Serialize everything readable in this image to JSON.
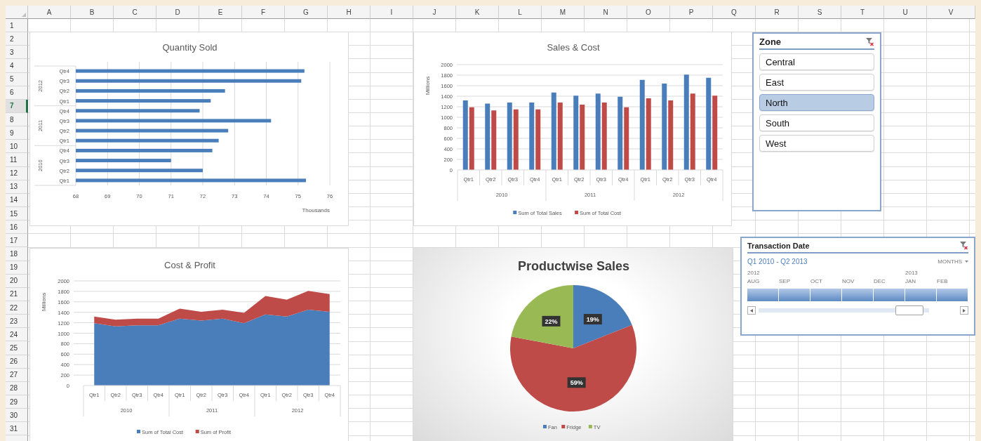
{
  "sheet": {
    "columns": [
      {
        "label": "A",
        "selected": false
      },
      {
        "label": "B",
        "selected": false
      },
      {
        "label": "C",
        "selected": false
      },
      {
        "label": "D",
        "selected": false
      },
      {
        "label": "E",
        "selected": false
      },
      {
        "label": "F",
        "selected": false
      },
      {
        "label": "G",
        "selected": false
      },
      {
        "label": "H",
        "selected": false
      },
      {
        "label": "I",
        "selected": false
      },
      {
        "label": "J",
        "selected": false
      },
      {
        "label": "K",
        "selected": false
      },
      {
        "label": "L",
        "selected": false
      },
      {
        "label": "M",
        "selected": false
      },
      {
        "label": "N",
        "selected": false
      },
      {
        "label": "O",
        "selected": false
      },
      {
        "label": "P",
        "selected": false
      },
      {
        "label": "Q",
        "selected": false
      },
      {
        "label": "R",
        "selected": false
      },
      {
        "label": "S",
        "selected": false
      },
      {
        "label": "T",
        "selected": false
      },
      {
        "label": "U",
        "selected": false
      },
      {
        "label": "V",
        "selected": false
      }
    ],
    "rows": [
      {
        "label": "1",
        "selected": false
      },
      {
        "label": "2",
        "selected": false
      },
      {
        "label": "3",
        "selected": false
      },
      {
        "label": "4",
        "selected": false
      },
      {
        "label": "5",
        "selected": false
      },
      {
        "label": "6",
        "selected": false
      },
      {
        "label": "7",
        "selected": true
      },
      {
        "label": "8",
        "selected": false
      },
      {
        "label": "9",
        "selected": false
      },
      {
        "label": "10",
        "selected": false
      },
      {
        "label": "11",
        "selected": false
      },
      {
        "label": "12",
        "selected": false
      },
      {
        "label": "13",
        "selected": false
      },
      {
        "label": "14",
        "selected": false
      },
      {
        "label": "15",
        "selected": false
      },
      {
        "label": "16",
        "selected": false
      },
      {
        "label": "17",
        "selected": false
      },
      {
        "label": "18",
        "selected": false
      },
      {
        "label": "19",
        "selected": false
      },
      {
        "label": "20",
        "selected": false
      },
      {
        "label": "21",
        "selected": false
      },
      {
        "label": "22",
        "selected": false
      },
      {
        "label": "23",
        "selected": false
      },
      {
        "label": "24",
        "selected": false
      },
      {
        "label": "25",
        "selected": false
      },
      {
        "label": "26",
        "selected": false
      },
      {
        "label": "27",
        "selected": false
      },
      {
        "label": "28",
        "selected": false
      },
      {
        "label": "29",
        "selected": false
      },
      {
        "label": "30",
        "selected": false
      },
      {
        "label": "31",
        "selected": false
      }
    ]
  },
  "charts": [
    {
      "axis_groups": [
        "2012",
        "2011",
        "2010"
      ],
      "chart_data": {
        "type": "bar",
        "orientation": "horizontal",
        "title": "Quantity Sold",
        "xlabel": "Thousands",
        "grid": true,
        "color": "#4a7ebb",
        "categories": [
          "Qtr4",
          "Qtr3",
          "Qtr2",
          "Qtr1",
          "Qtr4",
          "Qtr3",
          "Qtr2",
          "Qtr1",
          "Qtr4",
          "Qtr3",
          "Qtr2",
          "Qtr1"
        ],
        "values": [
          75.2,
          75.1,
          72.7,
          72.25,
          71.9,
          74.15,
          72.8,
          72.5,
          72.3,
          71.0,
          72.0,
          75.25
        ],
        "xlim": [
          68,
          76
        ],
        "xticks": [
          68,
          69,
          70,
          71,
          72,
          73,
          74,
          75,
          76
        ]
      }
    },
    {
      "axis_groups": [
        "2010",
        "2011",
        "2012"
      ],
      "chart_data": {
        "type": "bar",
        "orientation": "vertical",
        "title": "Sales & Cost",
        "ylabel": "Millions",
        "grid": true,
        "legend": "bottom",
        "categories": [
          "Qtr1",
          "Qtr2",
          "Qtr3",
          "Qtr4",
          "Qtr1",
          "Qtr2",
          "Qtr3",
          "Qtr4",
          "Qtr1",
          "Qtr2",
          "Qtr3",
          "Qtr4"
        ],
        "series": [
          {
            "name": "Sum of Total Sales",
            "color": "#4a7ebb",
            "values": [
              1320,
              1260,
              1280,
              1280,
              1470,
              1410,
              1450,
              1390,
              1710,
              1640,
              1810,
              1750
            ]
          },
          {
            "name": "Sum of Total Cost",
            "color": "#be4b48",
            "values": [
              1190,
              1130,
              1150,
              1150,
              1280,
              1240,
              1280,
              1190,
              1360,
              1320,
              1450,
              1410
            ]
          }
        ],
        "ylim": [
          0,
          2000
        ],
        "yticks": [
          0,
          200,
          400,
          600,
          800,
          1000,
          1200,
          1400,
          1600,
          1800,
          2000
        ]
      }
    },
    {
      "axis_groups": [
        "2010",
        "2011",
        "2012"
      ],
      "chart_data": {
        "type": "area",
        "stacked": true,
        "title": "Cost & Profit",
        "ylabel": "Millions",
        "grid": true,
        "legend": "bottom",
        "categories": [
          "Qtr1",
          "Qtr2",
          "Qtr3",
          "Qtr4",
          "Qtr1",
          "Qtr2",
          "Qtr3",
          "Qtr4",
          "Qtr1",
          "Qtr2",
          "Qtr3",
          "Qtr4"
        ],
        "series": [
          {
            "name": "Sum of Total Cost",
            "color": "#4a7ebb",
            "values": [
              1190,
              1130,
              1150,
              1150,
              1280,
              1240,
              1280,
              1190,
              1360,
              1320,
              1450,
              1410
            ]
          },
          {
            "name": "Sum of Profit",
            "color": "#be4b48",
            "values": [
              130,
              130,
              130,
              130,
              190,
              170,
              170,
              200,
              350,
              320,
              360,
              340
            ]
          }
        ],
        "ylim": [
          0,
          2000
        ],
        "yticks": [
          0,
          200,
          400,
          600,
          800,
          1000,
          1200,
          1400,
          1600,
          1800,
          2000
        ]
      }
    },
    {
      "chart_data": {
        "type": "pie",
        "title": "Productwise Sales",
        "legend": "bottom",
        "categories": [
          "Fan",
          "Fridge",
          "TV"
        ],
        "data_labels": true,
        "values": [
          19,
          59,
          22
        ],
        "colors": [
          "#4a7ebb",
          "#be4b48",
          "#98b954"
        ],
        "value_labels": [
          "19%",
          "59%",
          "22%"
        ]
      }
    }
  ],
  "zone_slicer": {
    "title": "Zone",
    "items": [
      {
        "label": "Central",
        "selected": false
      },
      {
        "label": "East",
        "selected": false
      },
      {
        "label": "North",
        "selected": true
      },
      {
        "label": "South",
        "selected": false
      },
      {
        "label": "West",
        "selected": false
      }
    ]
  },
  "timeline": {
    "title": "Transaction Date",
    "range": "Q1 2010 - Q2 2013",
    "level": "MONTHS",
    "months": [
      {
        "label": "AUG",
        "year": "2012",
        "selected": true
      },
      {
        "label": "SEP",
        "selected": true
      },
      {
        "label": "OCT",
        "selected": true
      },
      {
        "label": "NOV",
        "selected": true
      },
      {
        "label": "DEC",
        "selected": true
      },
      {
        "label": "JAN",
        "year": "2013",
        "selected": true
      },
      {
        "label": "FEB",
        "selected": true
      }
    ]
  }
}
